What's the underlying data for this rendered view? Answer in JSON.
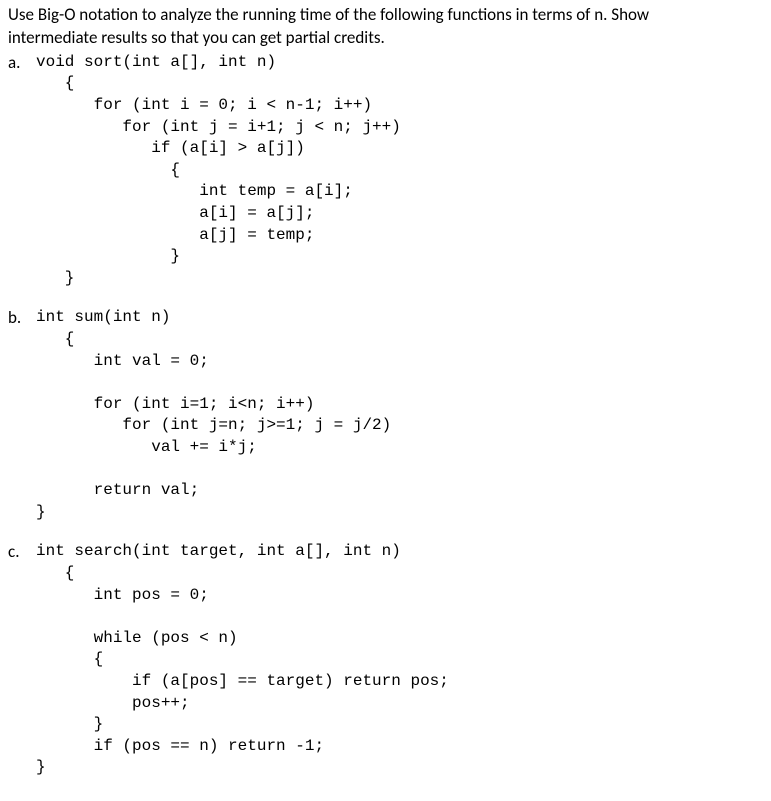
{
  "prompt_line1": "Use Big-O notation to analyze the running time of the following functions in terms of n. Show",
  "prompt_line2": "intermediate results so that you can get partial credits.",
  "parts": {
    "a": {
      "label": "a.",
      "code": "void sort(int a[], int n)\n   {\n      for (int i = 0; i < n-1; i++)\n         for (int j = i+1; j < n; j++)\n            if (a[i] > a[j])\n              {\n                 int temp = a[i];\n                 a[i] = a[j];\n                 a[j] = temp;\n              }\n   }"
    },
    "b": {
      "label": "b.",
      "code": "int sum(int n)\n   {\n      int val = 0;\n\n      for (int i=1; i<n; i++)\n         for (int j=n; j>=1; j = j/2)\n            val += i*j;\n\n      return val;\n}"
    },
    "c": {
      "label": "c.",
      "code": "int search(int target, int a[], int n)\n   {\n      int pos = 0;\n\n      while (pos < n)\n      {\n          if (a[pos] == target) return pos;\n          pos++;\n      }\n      if (pos == n) return -1;\n}"
    }
  }
}
